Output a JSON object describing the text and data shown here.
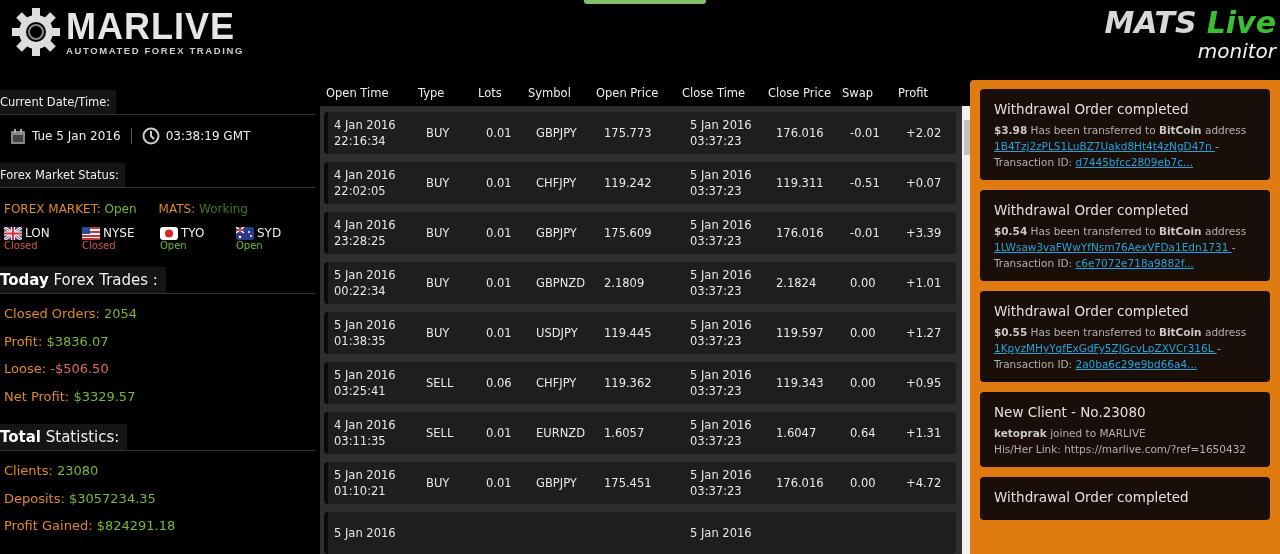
{
  "header": {
    "logo": {
      "name": "MARLIVE",
      "tagline": "AUTOMATED FOREX TRADING"
    },
    "monitor_logo": {
      "word1": "MATS",
      "word2": "Live",
      "word3": "monitor"
    }
  },
  "sidebar": {
    "datetime": {
      "heading": "Current Date/Time:",
      "date": "Tue 5 Jan 2016",
      "time": "03:38:19 GMT"
    },
    "market": {
      "heading": "Forex Market Status:",
      "statuses": [
        {
          "label": "FOREX MARKET:",
          "value": "Open",
          "kind": "open"
        },
        {
          "label": "MATS:",
          "value": "Working",
          "kind": "working"
        }
      ],
      "exchanges": [
        {
          "kind": "uk",
          "code": "LON",
          "status": "Closed",
          "open": false
        },
        {
          "kind": "us",
          "code": "NYSE",
          "status": "Closed",
          "open": false
        },
        {
          "kind": "jp",
          "code": "TYO",
          "status": "Open",
          "open": true
        },
        {
          "kind": "au",
          "code": "SYD",
          "status": "Open",
          "open": true
        }
      ]
    },
    "today": {
      "heading_bold": "Today",
      "heading": "Forex Trades :",
      "stats": [
        {
          "label": "Closed Orders:",
          "value": "2054",
          "kind": "positive"
        },
        {
          "label": "Profit:",
          "value": "$3836.07",
          "kind": "positive"
        },
        {
          "label": "Loose:",
          "value": "-$506.50",
          "kind": "negative"
        },
        {
          "label": "Net Profit:",
          "value": "$3329.57",
          "kind": "positive"
        }
      ]
    },
    "total": {
      "heading_bold": "Total",
      "heading": "Statistics:",
      "stats": [
        {
          "label": "Clients:",
          "value": "23080",
          "kind": "positive"
        },
        {
          "label": "Deposits:",
          "value": "$3057234.35",
          "kind": "positive"
        },
        {
          "label": "Profit Gained:",
          "value": "$824291.18",
          "kind": "positive"
        }
      ]
    }
  },
  "table": {
    "columns": [
      "Open Time",
      "Type",
      "Lots",
      "Symbol",
      "Open Price",
      "Close Time",
      "Close Price",
      "Swap",
      "Profit"
    ],
    "rows": [
      {
        "open_date": "4 Jan 2016",
        "open_time": "22:16:34",
        "type": "BUY",
        "lots": "0.01",
        "symbol": "GBPJPY",
        "open_price": "175.773",
        "close_date": "5 Jan 2016",
        "close_time": "03:37:23",
        "close_price": "176.016",
        "swap": "-0.01",
        "profit": "+2.02"
      },
      {
        "open_date": "4 Jan 2016",
        "open_time": "22:02:05",
        "type": "BUY",
        "lots": "0.01",
        "symbol": "CHFJPY",
        "open_price": "119.242",
        "close_date": "5 Jan 2016",
        "close_time": "03:37:23",
        "close_price": "119.311",
        "swap": "-0.51",
        "profit": "+0.07"
      },
      {
        "open_date": "4 Jan 2016",
        "open_time": "23:28:25",
        "type": "BUY",
        "lots": "0.01",
        "symbol": "GBPJPY",
        "open_price": "175.609",
        "close_date": "5 Jan 2016",
        "close_time": "03:37:23",
        "close_price": "176.016",
        "swap": "-0.01",
        "profit": "+3.39"
      },
      {
        "open_date": "5 Jan 2016",
        "open_time": "00:22:34",
        "type": "BUY",
        "lots": "0.01",
        "symbol": "GBPNZD",
        "open_price": "2.1809",
        "close_date": "5 Jan 2016",
        "close_time": "03:37:23",
        "close_price": "2.1824",
        "swap": "0.00",
        "profit": "+1.01"
      },
      {
        "open_date": "5 Jan 2016",
        "open_time": "01:38:35",
        "type": "BUY",
        "lots": "0.01",
        "symbol": "USDJPY",
        "open_price": "119.445",
        "close_date": "5 Jan 2016",
        "close_time": "03:37:23",
        "close_price": "119.597",
        "swap": "0.00",
        "profit": "+1.27"
      },
      {
        "open_date": "5 Jan 2016",
        "open_time": "03:25:41",
        "type": "SELL",
        "lots": "0.06",
        "symbol": "CHFJPY",
        "open_price": "119.362",
        "close_date": "5 Jan 2016",
        "close_time": "03:37:23",
        "close_price": "119.343",
        "swap": "0.00",
        "profit": "+0.95"
      },
      {
        "open_date": "4 Jan 2016",
        "open_time": "03:11:35",
        "type": "SELL",
        "lots": "0.01",
        "symbol": "EURNZD",
        "open_price": "1.6057",
        "close_date": "5 Jan 2016",
        "close_time": "03:37:23",
        "close_price": "1.6047",
        "swap": "0.64",
        "profit": "+1.31"
      },
      {
        "open_date": "5 Jan 2016",
        "open_time": "01:10:21",
        "type": "BUY",
        "lots": "0.01",
        "symbol": "GBPJPY",
        "open_price": "175.451",
        "close_date": "5 Jan 2016",
        "close_time": "03:37:23",
        "close_price": "176.016",
        "swap": "0.00",
        "profit": "+4.72"
      },
      {
        "open_date": "5 Jan 2016",
        "close_date": "5 Jan 2016"
      }
    ]
  },
  "feed": [
    {
      "kind": "withdrawal",
      "title": "Withdrawal Order completed",
      "text": "**$3.98** Has been transferred to **BitCoin** address",
      "address": "1B4Tzj2zPLS1LuBZ7Uakd8Ht4t4zNgD47n",
      "separator": "-",
      "tx_label": "Transaction ID:",
      "tx_id": "d7445bfcc2809eb7c..."
    },
    {
      "kind": "withdrawal",
      "title": "Withdrawal Order completed",
      "text": "**$0.54** Has been transferred to **BitCoin** address",
      "address": "1LWsaw3vaFWwYfNsm76AexVFDa1Edn1731",
      "separator": "-",
      "tx_label": "Transaction ID:",
      "tx_id": "c6e7072e718a9882f..."
    },
    {
      "kind": "withdrawal",
      "title": "Withdrawal Order completed",
      "text": "**$0.55** Has been transferred to **BitCoin** address",
      "address": "1KpyzMHyYqfExGdFy5ZJGcvLpZXVCr316L",
      "separator": "-",
      "tx_label": "Transaction ID:",
      "tx_id": "2a0ba6c29e9bd66a4..."
    },
    {
      "kind": "client",
      "title": "New Client - No.23080",
      "text": "**ketoprak** joined to MARLIVE",
      "link_line": "His/Her Link: https://marlive.com/?ref=1650432"
    },
    {
      "kind": "withdrawal",
      "title": "Withdrawal Order completed"
    }
  ]
}
